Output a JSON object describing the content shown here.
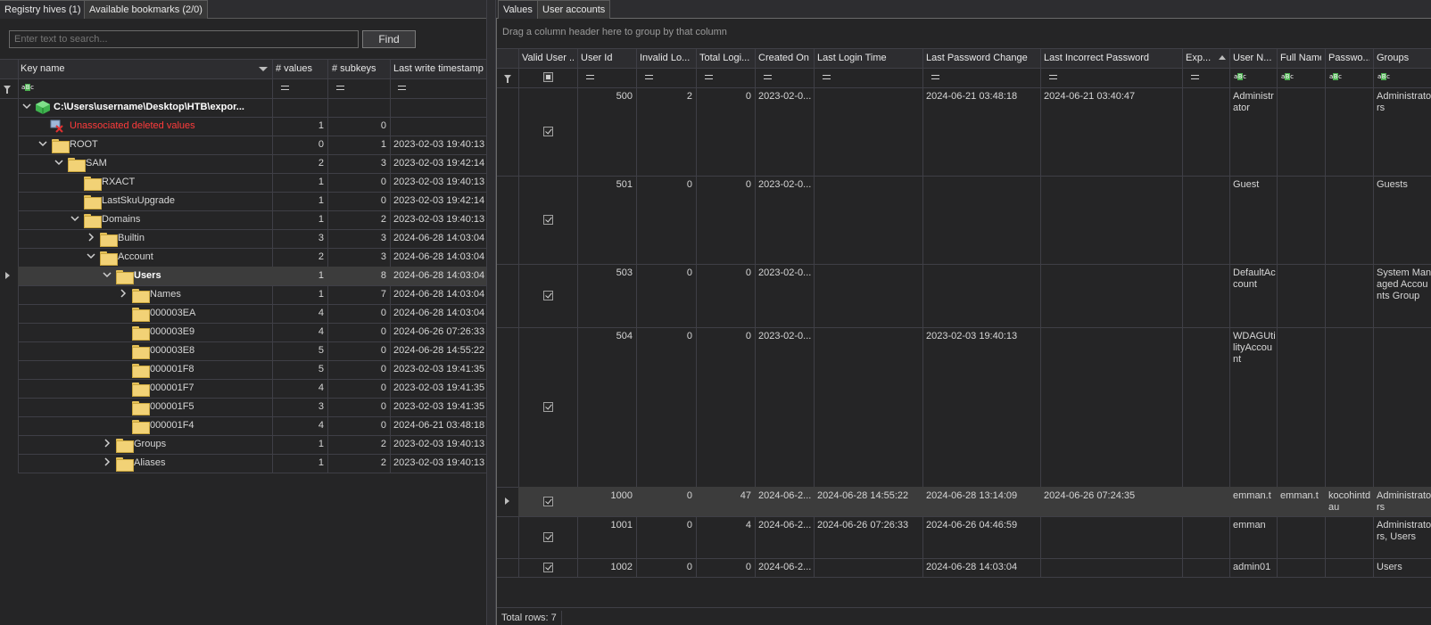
{
  "left_tabs": [
    "Registry hives (1)",
    "Available bookmarks (2/0)"
  ],
  "search": {
    "placeholder": "Enter text to search...",
    "find_label": "Find"
  },
  "tree_columns": {
    "key_name": "Key name",
    "values": "# values",
    "subkeys": "# subkeys",
    "timestamp": "Last write timestamp"
  },
  "tree_rows": [
    {
      "name": "C:\\Users\\username\\Desktop\\HTB\\expor...",
      "values": "",
      "subkeys": "",
      "ts": "",
      "level": 0,
      "expander": "down",
      "icon": "hive-cube-icon",
      "bold": true
    },
    {
      "name": "Unassociated deleted values",
      "values": "1",
      "subkeys": "0",
      "ts": "",
      "level": 1,
      "expander": "none",
      "icon": "deleted-values-icon",
      "red": true
    },
    {
      "name": "ROOT",
      "values": "0",
      "subkeys": "1",
      "ts": "2023-02-03 19:40:13",
      "level": 1,
      "expander": "down",
      "icon": "folder-icon"
    },
    {
      "name": "SAM",
      "values": "2",
      "subkeys": "3",
      "ts": "2023-02-03 19:42:14",
      "level": 2,
      "expander": "down",
      "icon": "folder-icon"
    },
    {
      "name": "RXACT",
      "values": "1",
      "subkeys": "0",
      "ts": "2023-02-03 19:40:13",
      "level": 3,
      "expander": "none",
      "icon": "folder-icon"
    },
    {
      "name": "LastSkuUpgrade",
      "values": "1",
      "subkeys": "0",
      "ts": "2023-02-03 19:42:14",
      "level": 3,
      "expander": "none",
      "icon": "folder-icon"
    },
    {
      "name": "Domains",
      "values": "1",
      "subkeys": "2",
      "ts": "2023-02-03 19:40:13",
      "level": 3,
      "expander": "down",
      "icon": "folder-icon"
    },
    {
      "name": "Builtin",
      "values": "3",
      "subkeys": "3",
      "ts": "2024-06-28 14:03:04",
      "level": 4,
      "expander": "right",
      "icon": "folder-icon"
    },
    {
      "name": "Account",
      "values": "2",
      "subkeys": "3",
      "ts": "2024-06-28 14:03:04",
      "level": 4,
      "expander": "down",
      "icon": "folder-icon"
    },
    {
      "name": "Users",
      "values": "1",
      "subkeys": "8",
      "ts": "2024-06-28 14:03:04",
      "level": 5,
      "expander": "down",
      "icon": "folder-icon",
      "bold": true,
      "selected": true
    },
    {
      "name": "Names",
      "values": "1",
      "subkeys": "7",
      "ts": "2024-06-28 14:03:04",
      "level": 6,
      "expander": "right",
      "icon": "folder-icon"
    },
    {
      "name": "000003EA",
      "values": "4",
      "subkeys": "0",
      "ts": "2024-06-28 14:03:04",
      "level": 6,
      "expander": "none",
      "icon": "folder-icon"
    },
    {
      "name": "000003E9",
      "values": "4",
      "subkeys": "0",
      "ts": "2024-06-26 07:26:33",
      "level": 6,
      "expander": "none",
      "icon": "folder-icon"
    },
    {
      "name": "000003E8",
      "values": "5",
      "subkeys": "0",
      "ts": "2024-06-28 14:55:22",
      "level": 6,
      "expander": "none",
      "icon": "folder-icon"
    },
    {
      "name": "000001F8",
      "values": "5",
      "subkeys": "0",
      "ts": "2023-02-03 19:41:35",
      "level": 6,
      "expander": "none",
      "icon": "folder-icon"
    },
    {
      "name": "000001F7",
      "values": "4",
      "subkeys": "0",
      "ts": "2023-02-03 19:41:35",
      "level": 6,
      "expander": "none",
      "icon": "folder-icon"
    },
    {
      "name": "000001F5",
      "values": "3",
      "subkeys": "0",
      "ts": "2023-02-03 19:41:35",
      "level": 6,
      "expander": "none",
      "icon": "folder-icon"
    },
    {
      "name": "000001F4",
      "values": "4",
      "subkeys": "0",
      "ts": "2024-06-21 03:48:18",
      "level": 6,
      "expander": "none",
      "icon": "folder-icon"
    },
    {
      "name": "Groups",
      "values": "1",
      "subkeys": "2",
      "ts": "2023-02-03 19:40:13",
      "level": 5,
      "expander": "right",
      "icon": "folder-icon"
    },
    {
      "name": "Aliases",
      "values": "1",
      "subkeys": "2",
      "ts": "2023-02-03 19:40:13",
      "level": 5,
      "expander": "right",
      "icon": "folder-icon"
    }
  ],
  "right_tabs": [
    "Values",
    "User accounts"
  ],
  "group_hint": "Drag a column header here to group by that column",
  "account_columns": [
    "Valid User ...",
    "User Id",
    "Invalid Lo...",
    "Total Logi...",
    "Created On",
    "Last Login Time",
    "Last Password Change",
    "Last Incorrect Password",
    "Exp...",
    "User N...",
    "Full Name",
    "Passwo...",
    "Groups"
  ],
  "accounts": [
    {
      "valid": true,
      "user_id": "500",
      "invalid": "2",
      "total": "0",
      "created": "2023-02-0...",
      "last_login": "",
      "last_pw": "2024-06-21 03:48:18",
      "last_bad": "2024-06-21 03:40:47",
      "exp": "",
      "user_name": "Administrator",
      "full_name": "",
      "password": "",
      "groups": "Administrators"
    },
    {
      "valid": true,
      "user_id": "501",
      "invalid": "0",
      "total": "0",
      "created": "2023-02-0...",
      "last_login": "",
      "last_pw": "",
      "last_bad": "",
      "exp": "",
      "user_name": "Guest",
      "full_name": "",
      "password": "",
      "groups": "Guests"
    },
    {
      "valid": true,
      "user_id": "503",
      "invalid": "0",
      "total": "0",
      "created": "2023-02-0...",
      "last_login": "",
      "last_pw": "",
      "last_bad": "",
      "exp": "",
      "user_name": "DefaultAccount",
      "full_name": "",
      "password": "",
      "groups": "System Managed Accounts Group"
    },
    {
      "valid": true,
      "user_id": "504",
      "invalid": "0",
      "total": "0",
      "created": "2023-02-0...",
      "last_login": "",
      "last_pw": "2023-02-03 19:40:13",
      "last_bad": "",
      "exp": "",
      "user_name": "WDAGUtilityAccount",
      "full_name": "",
      "password": "",
      "groups": ""
    },
    {
      "valid": true,
      "user_id": "1000",
      "invalid": "0",
      "total": "47",
      "created": "2024-06-2...",
      "last_login": "2024-06-28 14:55:22",
      "last_pw": "2024-06-28 13:14:09",
      "last_bad": "2024-06-26 07:24:35",
      "exp": "",
      "user_name": "emman.t",
      "full_name": "emman.t",
      "password": "kocohintdau",
      "groups": "Administrators"
    },
    {
      "valid": true,
      "user_id": "1001",
      "invalid": "0",
      "total": "4",
      "created": "2024-06-2...",
      "last_login": "2024-06-26 07:26:33",
      "last_pw": "2024-06-26 04:46:59",
      "last_bad": "",
      "exp": "",
      "user_name": "emman",
      "full_name": "",
      "password": "",
      "groups": "Administrators, Users"
    },
    {
      "valid": true,
      "user_id": "1002",
      "invalid": "0",
      "total": "0",
      "created": "2024-06-2...",
      "last_login": "",
      "last_pw": "2024-06-28 14:03:04",
      "last_bad": "",
      "exp": "",
      "user_name": "admin01",
      "full_name": "",
      "password": "",
      "groups": "Users"
    }
  ],
  "total_rows": "Total rows: 7"
}
